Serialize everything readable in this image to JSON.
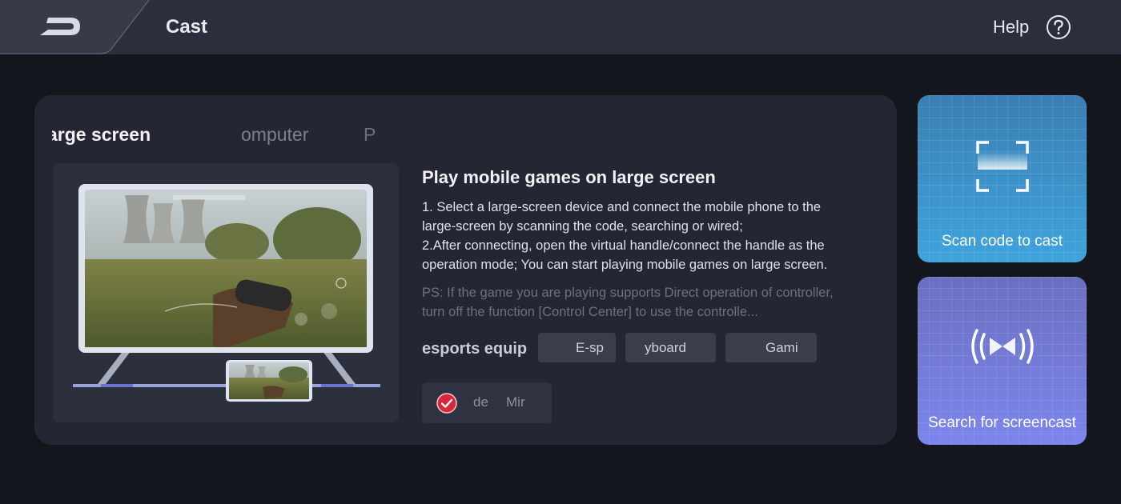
{
  "header": {
    "title": "Cast",
    "help_label": "Help"
  },
  "tabs": [
    {
      "label": "arge screen",
      "active": true
    },
    {
      "label": "omputer",
      "active": false
    },
    {
      "label": "P",
      "active": false
    }
  ],
  "info": {
    "title": "Play mobile games on large screen",
    "step1": "1. Select a large-screen device and connect the mobile phone to the large-screen by scanning the code, searching or wired;",
    "step2": "2.After connecting, open the virtual handle/connect the handle as the operation mode; You can start playing mobile games on large screen.",
    "ps": "PS: If the game you are playing supports Direct operation of controller, turn off the function [Control Center] to use the controlle..."
  },
  "esports": {
    "label": "esports equip",
    "chips": [
      "E-sp",
      "yboard",
      "Gami"
    ]
  },
  "mode": {
    "checked": true,
    "text1": "de",
    "text2": "Mir"
  },
  "side": {
    "scan_label": "Scan code to cast",
    "search_label": "Search for screencast"
  },
  "colors": {
    "background": "#14161d",
    "topbar": "#2b2f3d",
    "card": "#242733",
    "scan_card": "#3fa3dc",
    "search_card": "#7c85ec",
    "check": "#d8263b"
  },
  "icons": {
    "back": "back-arrow-icon",
    "help": "question-circle-icon",
    "scan": "scan-frame-icon",
    "search": "broadcast-icon",
    "check": "check-circle-icon"
  }
}
